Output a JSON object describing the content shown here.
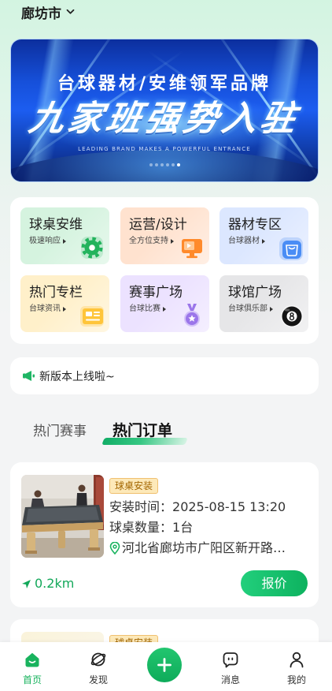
{
  "theme": {
    "primary": "#19b35e"
  },
  "header": {
    "city": "廊坊市",
    "dropdown_icon": "chevron-down-icon"
  },
  "banner": {
    "headline": "台球器材/安维领军品牌",
    "title": "九家班强势入驻",
    "subtitle": "LEADING BRAND MAKES A POWERFUL ENTRANCE",
    "dot_count": 6,
    "active_dot": 5
  },
  "services": [
    {
      "title": "球桌安维",
      "desc": "极速响应",
      "icon": "gear-icon",
      "accent": "#22b35c",
      "bg": "#d5f3df"
    },
    {
      "title": "运营/设计",
      "desc": "全方位支持",
      "icon": "monitor-icon",
      "accent": "#ff8a2b",
      "bg": "#ffe2cf"
    },
    {
      "title": "器材专区",
      "desc": "台球器材",
      "icon": "shopping-bag-icon",
      "accent": "#4a8df5",
      "bg": "#dce7ff"
    },
    {
      "title": "热门专栏",
      "desc": "台球资讯",
      "icon": "news-card-icon",
      "accent": "#ffc53a",
      "bg": "#fff0ca"
    },
    {
      "title": "赛事广场",
      "desc": "台球比赛",
      "icon": "medal-icon",
      "accent": "#9b76ea",
      "bg": "#ece2ff"
    },
    {
      "title": "球馆广场",
      "desc": "台球俱乐部",
      "icon": "eight-ball-icon",
      "accent": "#151515",
      "bg": "#e6e6e8"
    }
  ],
  "notice": {
    "icon": "speaker-icon",
    "text": "新版本上线啦~"
  },
  "tabs": [
    {
      "label": "热门赛事",
      "active": false
    },
    {
      "label": "热门订单",
      "active": true
    }
  ],
  "orders": [
    {
      "tag": "球桌安装",
      "time_label": "安装时间：",
      "time": "2025-08-15 13:20",
      "quantity_label": "球桌数量：",
      "quantity": "1台",
      "address": "河北省廊坊市广阳区新开路…",
      "distance": "0.2km",
      "action": "报价"
    },
    {
      "tag": "球桌安装"
    }
  ],
  "tabbar": {
    "items": [
      {
        "label": "首页",
        "icon": "home-icon",
        "active": true
      },
      {
        "label": "发现",
        "icon": "planet-icon",
        "active": false
      },
      {
        "label": "消息",
        "icon": "message-icon",
        "active": false
      },
      {
        "label": "我的",
        "icon": "user-icon",
        "active": false
      }
    ],
    "publish_icon": "plus-icon"
  }
}
